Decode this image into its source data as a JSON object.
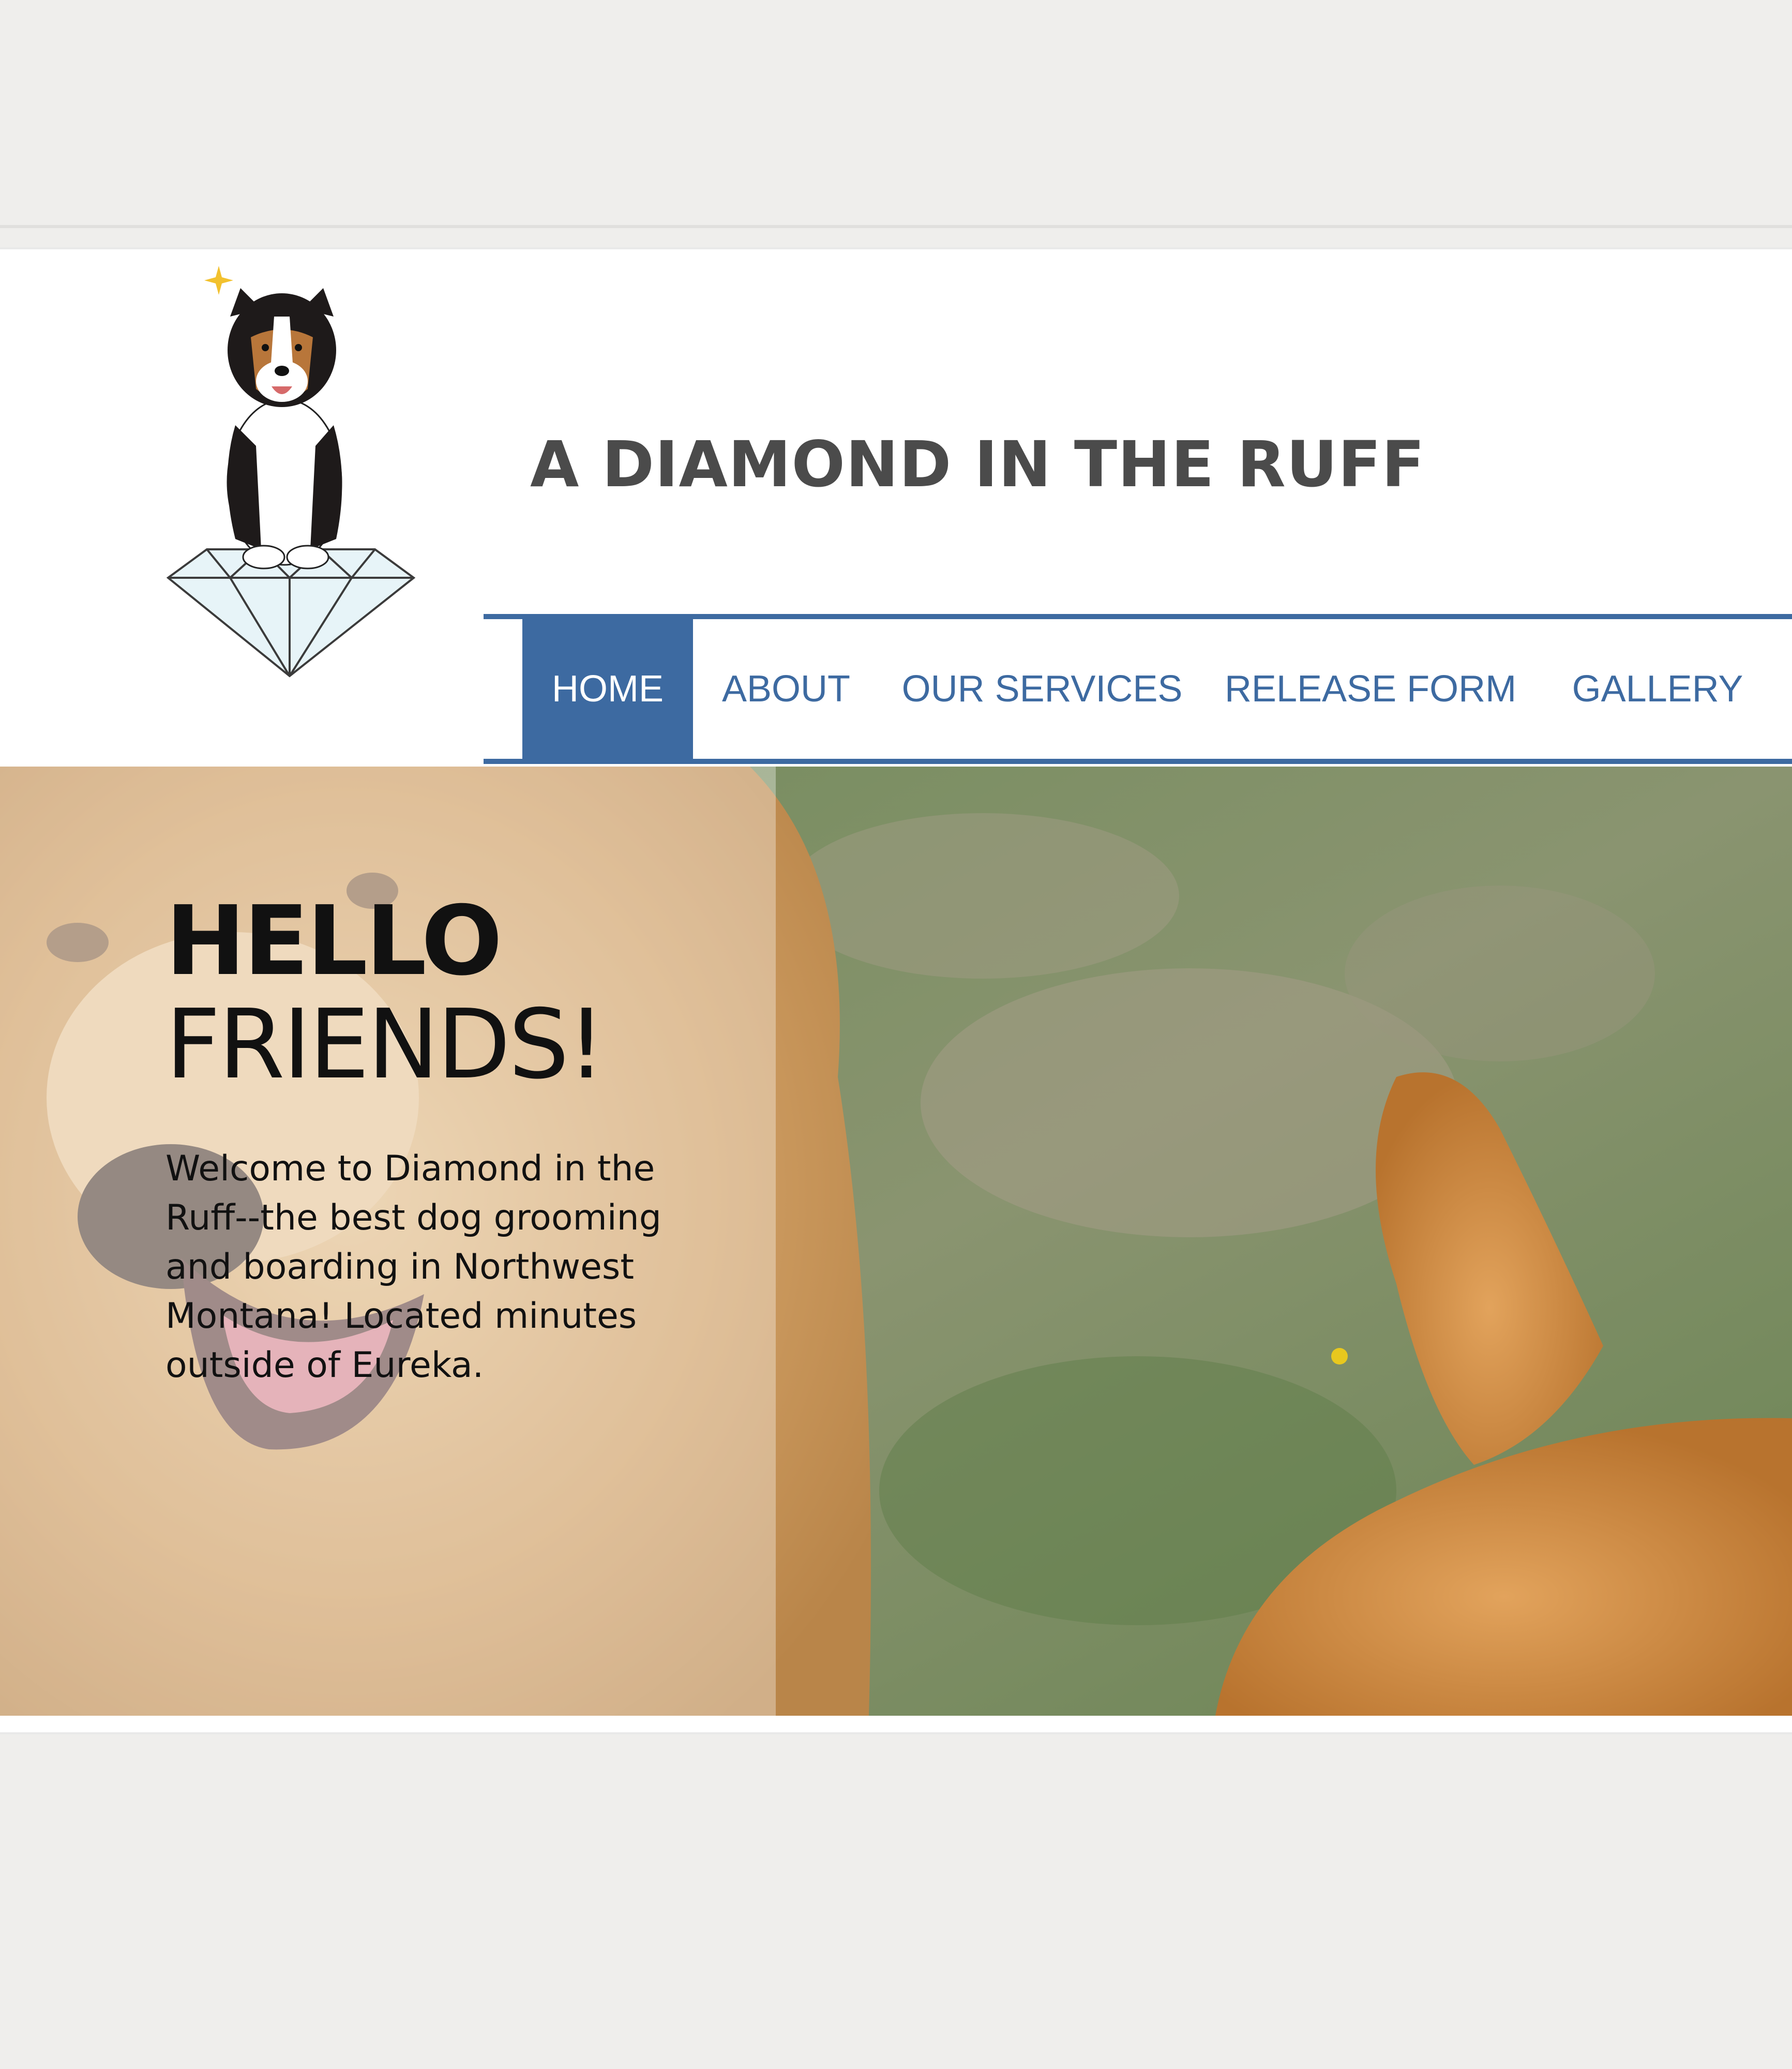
{
  "site": {
    "title": "A DIAMOND IN THE RUFF"
  },
  "nav": {
    "items": [
      {
        "label": "HOME",
        "active": true
      },
      {
        "label": "ABOUT",
        "active": false
      },
      {
        "label": "OUR SERVICES",
        "active": false
      },
      {
        "label": "RELEASE FORM",
        "active": false
      },
      {
        "label": "GALLERY",
        "active": false
      }
    ]
  },
  "hero": {
    "heading_bold": "HELLO",
    "heading_light": "FRIENDS!",
    "body": "Welcome to Diamond in the Ruff--the best dog grooming and boarding in Northwest Montana! Located minutes outside of Eureka.",
    "image": "golden-retriever-photo"
  },
  "logo": {
    "image": "dog-on-diamond-logo"
  },
  "colors": {
    "accent": "#3d6aa1",
    "title": "#4b4b4b",
    "background": "#efeeec"
  }
}
